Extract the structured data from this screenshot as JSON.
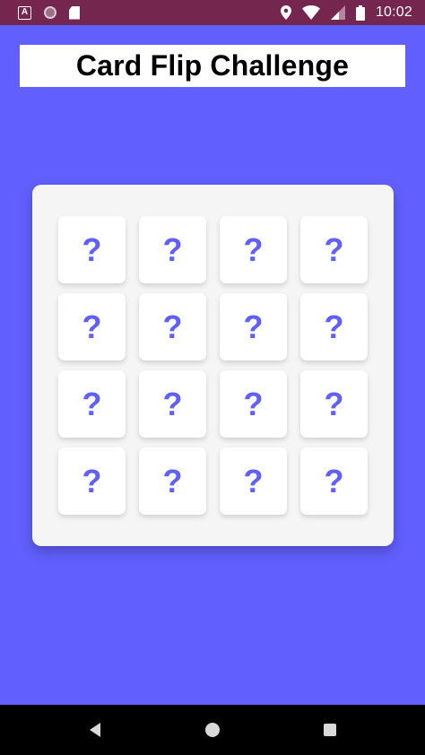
{
  "status_bar": {
    "time": "10:02",
    "left_icons": [
      "a-notification-icon",
      "circle-notification-icon",
      "sd-card-icon"
    ],
    "right_icons": [
      "location-icon",
      "wifi-icon",
      "signal-icon",
      "battery-icon"
    ]
  },
  "header": {
    "title": "Card Flip Challenge"
  },
  "board": {
    "rows": 4,
    "columns": 4,
    "cards": [
      {
        "face": "?"
      },
      {
        "face": "?"
      },
      {
        "face": "?"
      },
      {
        "face": "?"
      },
      {
        "face": "?"
      },
      {
        "face": "?"
      },
      {
        "face": "?"
      },
      {
        "face": "?"
      },
      {
        "face": "?"
      },
      {
        "face": "?"
      },
      {
        "face": "?"
      },
      {
        "face": "?"
      },
      {
        "face": "?"
      },
      {
        "face": "?"
      },
      {
        "face": "?"
      },
      {
        "face": "?"
      }
    ]
  },
  "nav_bar": {
    "buttons": [
      "back-icon",
      "home-icon",
      "recents-icon"
    ]
  },
  "colors": {
    "background": "#6160FF",
    "status_bar": "#74264F",
    "card_mark": "#6160FF",
    "board": "#F5F5F5",
    "card": "#FFFFFF"
  }
}
